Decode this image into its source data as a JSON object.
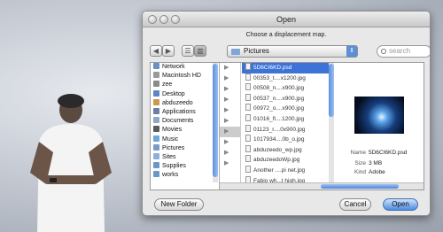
{
  "dialog": {
    "title": "Open",
    "prompt": "Choose a displacement map.",
    "path_label": "Pictures",
    "search_placeholder": "search",
    "sidebar": [
      {
        "label": "Network",
        "icon": "network-icon",
        "color": "#6a8fc0"
      },
      {
        "label": "Macintosh HD",
        "icon": "hard-drive-icon",
        "color": "#9a9a9a"
      },
      {
        "label": "zee",
        "icon": "disk-icon",
        "color": "#8a8a8a"
      },
      {
        "label": "Desktop",
        "icon": "desktop-icon",
        "color": "#5b87c8"
      },
      {
        "label": "abduzeedo",
        "icon": "home-icon",
        "color": "#c99a4a"
      },
      {
        "label": "Applications",
        "icon": "applications-icon",
        "color": "#6a7fa8"
      },
      {
        "label": "Documents",
        "icon": "documents-icon",
        "color": "#8fa7c9"
      },
      {
        "label": "Movies",
        "icon": "movies-icon",
        "color": "#5a5a5a"
      },
      {
        "label": "Music",
        "icon": "music-icon",
        "color": "#6fa6d8"
      },
      {
        "label": "Pictures",
        "icon": "pictures-icon",
        "color": "#7c9bc4"
      },
      {
        "label": "Sites",
        "icon": "sites-icon",
        "color": "#8cb0d8"
      },
      {
        "label": "Supplies",
        "icon": "folder-icon",
        "color": "#6d96c9"
      },
      {
        "label": "works",
        "icon": "folder-icon",
        "color": "#6d96c9"
      }
    ],
    "parent_column": [
      "▶",
      "▶",
      "▶",
      "▶",
      "▶",
      "▶",
      "▶",
      "▶",
      "▶",
      "▶"
    ],
    "files": [
      "5D6CI6KD.psd",
      "00353_t....x1200.jpg",
      "00508_n....x900.jpg",
      "00537_n....x900.jpg",
      "00972_o....x900.jpg",
      "01016_fl....1200.jpg",
      "01123_r....0x900.jpg",
      "1017934....0b_o.jpg",
      "abduzeedo_wp.jpg",
      "abduzeedoWp.jpg",
      "Another ....pi net.jpg",
      "Fabio wh...t high.jpg"
    ],
    "selected_file_index": 0,
    "preview": {
      "name_key": "Name",
      "name_value": "5D6CI6KD.psd",
      "size_key": "Size",
      "size_value": "3 MB",
      "kind_key": "Kind",
      "kind_value": "Adobe"
    },
    "buttons": {
      "new_folder": "New Folder",
      "cancel": "Cancel",
      "open": "Open"
    }
  }
}
